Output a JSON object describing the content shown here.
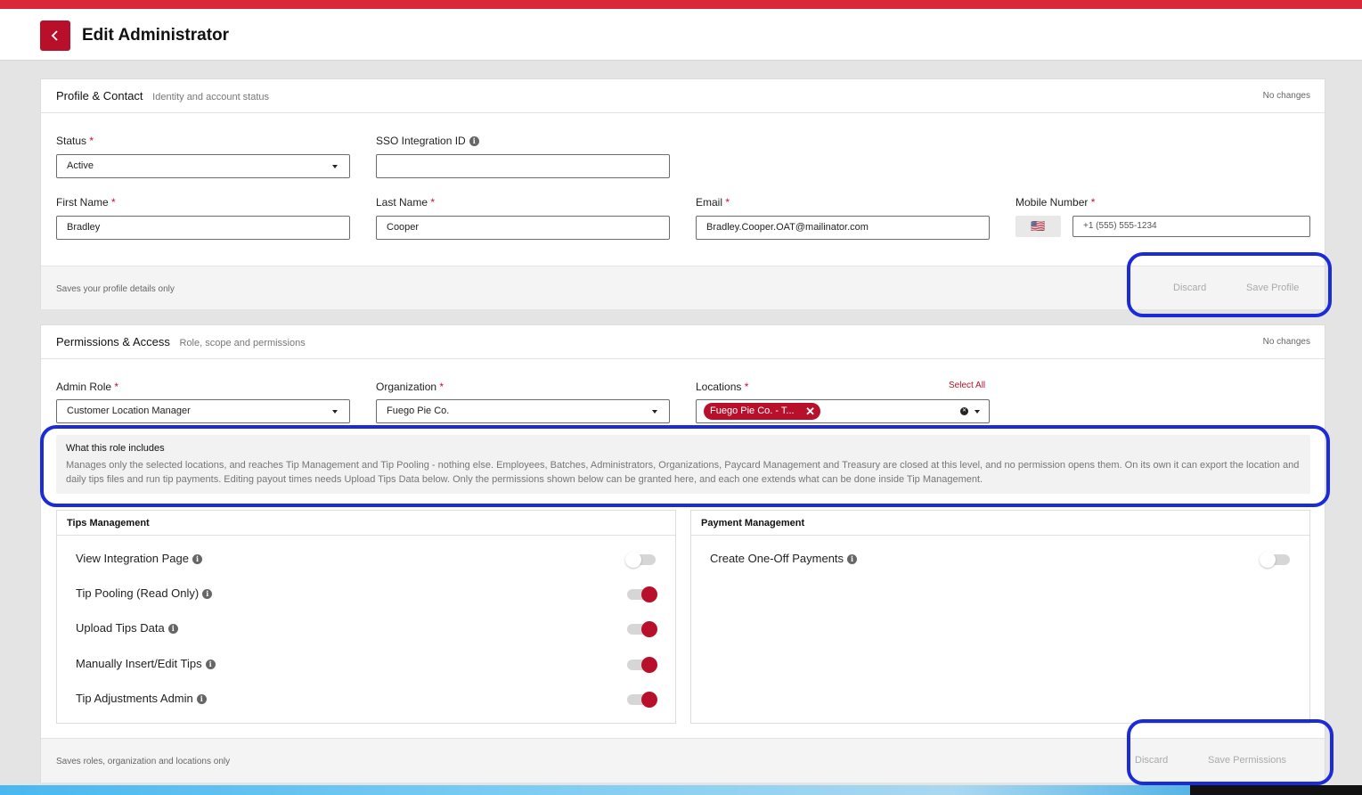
{
  "header": {
    "title": "Edit Administrator"
  },
  "profile": {
    "title": "Profile & Contact",
    "subtitle": "Identity and account status",
    "status_text": "No changes",
    "required_mark": "*",
    "fields": {
      "status": {
        "label": "Status",
        "value": "Active"
      },
      "sso": {
        "label": "SSO Integration ID",
        "value": ""
      },
      "first_name": {
        "label": "First Name",
        "value": "Bradley"
      },
      "last_name": {
        "label": "Last Name",
        "value": "Cooper"
      },
      "email": {
        "label": "Email",
        "value": "Bradley.Cooper.OAT@mailinator.com"
      },
      "mobile": {
        "label": "Mobile Number",
        "flag": "🇺🇸",
        "value": "+1 (555) 555-1234"
      }
    },
    "footer": {
      "note": "Saves your profile details only",
      "discard": "Discard",
      "save": "Save Profile"
    }
  },
  "permissions": {
    "title": "Permissions & Access",
    "subtitle": "Role, scope and permissions",
    "status_text": "No changes",
    "fields": {
      "admin_role": {
        "label": "Admin Role",
        "value": "Customer Location Manager"
      },
      "organization": {
        "label": "Organization",
        "value": "Fuego Pie Co."
      },
      "locations": {
        "label": "Locations",
        "select_all": "Select All",
        "chip": "Fuego Pie Co. - T..."
      }
    },
    "role_info": {
      "title": "What this role includes",
      "body": "Manages only the selected locations, and reaches Tip Management and Tip Pooling - nothing else. Employees, Batches, Administrators, Organizations, Paycard Management and Treasury are closed at this level, and no permission opens them. On its own it can export the location and daily tips files and run tip payments. Editing payout times needs Upload Tips Data below. Only the permissions shown below can be granted here, and each one extends what can be done inside Tip Management."
    },
    "tips_management": {
      "title": "Tips Management",
      "items": [
        {
          "label": "View Integration Page",
          "enabled": false
        },
        {
          "label": "Tip Pooling (Read Only)",
          "enabled": true
        },
        {
          "label": "Upload Tips Data",
          "enabled": true
        },
        {
          "label": "Manually Insert/Edit Tips",
          "enabled": true
        },
        {
          "label": "Tip Adjustments Admin",
          "enabled": true
        }
      ]
    },
    "payment_management": {
      "title": "Payment Management",
      "items": [
        {
          "label": "Create One-Off Payments",
          "enabled": false
        }
      ]
    },
    "footer": {
      "note": "Saves roles, organization and locations only",
      "discard": "Discard",
      "save": "Save Permissions"
    }
  },
  "colors": {
    "brand": "#b8102b",
    "top_bar": "#d8283a",
    "highlight": "#1b2bd9"
  }
}
